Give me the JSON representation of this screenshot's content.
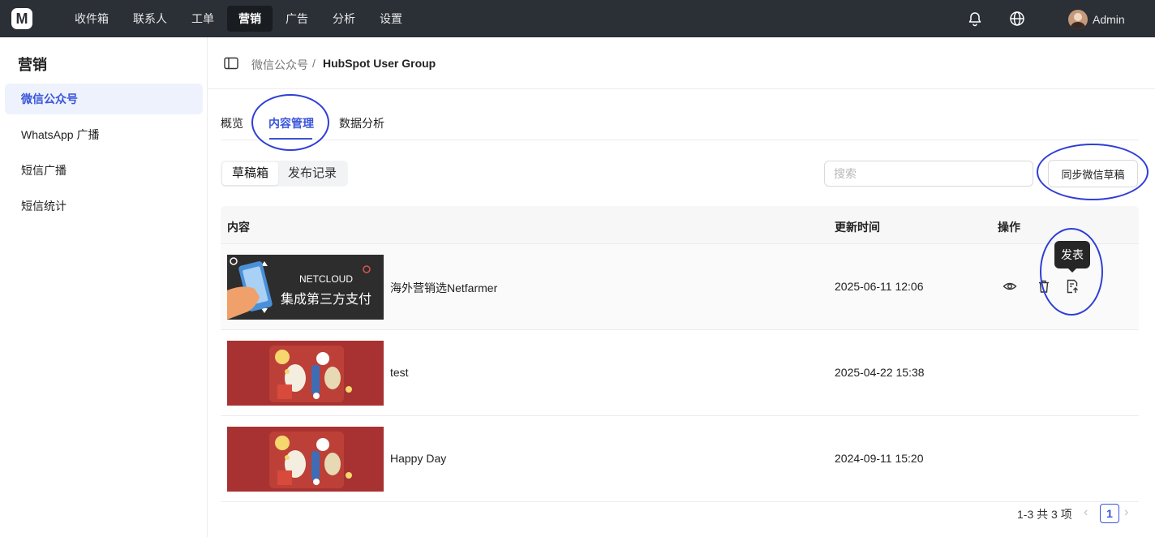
{
  "topbar": {
    "logo_glyph": "M",
    "nav": [
      "收件箱",
      "联系人",
      "工单",
      "营销",
      "广告",
      "分析",
      "设置"
    ],
    "active_nav": "营销",
    "user_name": "Admin"
  },
  "sidebar": {
    "title": "营销",
    "items": [
      "微信公众号",
      "WhatsApp 广播",
      "短信广播",
      "短信统计"
    ],
    "active_item": "微信公众号"
  },
  "breadcrumb": {
    "parent": "微信公众号",
    "separator": "/",
    "current": "HubSpot User Group"
  },
  "tabs": [
    "概览",
    "内容管理",
    "数据分析"
  ],
  "active_tab": "内容管理",
  "segments": [
    "草稿箱",
    "发布记录"
  ],
  "active_segment": "草稿箱",
  "search": {
    "placeholder": "搜索"
  },
  "sync_button": "同步微信草稿",
  "table": {
    "columns": [
      "内容",
      "更新时间",
      "操作"
    ],
    "rows": [
      {
        "title": "海外营销选Netfarmer",
        "updated": "2025-06-11 12:06",
        "thumb_type": "netcloud",
        "thumb_text_top": "NETCLOUD",
        "thumb_text_bottom": "集成第三方支付"
      },
      {
        "title": "test",
        "updated": "2025-04-22 15:38",
        "thumb_type": "festival"
      },
      {
        "title": "Happy Day",
        "updated": "2024-09-11 15:20",
        "thumb_type": "festival"
      }
    ],
    "actions": [
      "eye-icon",
      "trash-icon",
      "publish-icon"
    ]
  },
  "tooltip": "发表",
  "pagination": {
    "total_text": "1-3 共 3 项",
    "current_page": "1"
  },
  "colors": {
    "topbar": "#2b2f36",
    "accent": "#3b55d9",
    "annotation": "#2f3ed6",
    "thumb_red": "#a83232",
    "thumb_dark": "#2d2d2d"
  }
}
